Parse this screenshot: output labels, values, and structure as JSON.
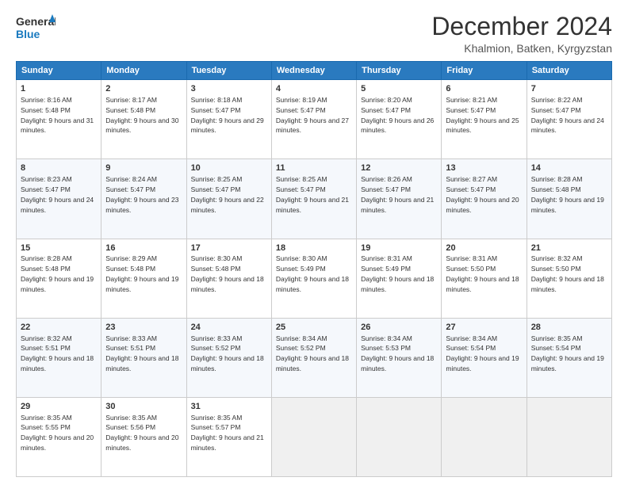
{
  "logo": {
    "line1": "General",
    "line2": "Blue"
  },
  "title": "December 2024",
  "subtitle": "Khalmion, Batken, Kyrgyzstan",
  "weekdays": [
    "Sunday",
    "Monday",
    "Tuesday",
    "Wednesday",
    "Thursday",
    "Friday",
    "Saturday"
  ],
  "weeks": [
    [
      {
        "day": "1",
        "sunrise": "8:16 AM",
        "sunset": "5:48 PM",
        "daylight": "9 hours and 31 minutes."
      },
      {
        "day": "2",
        "sunrise": "8:17 AM",
        "sunset": "5:48 PM",
        "daylight": "9 hours and 30 minutes."
      },
      {
        "day": "3",
        "sunrise": "8:18 AM",
        "sunset": "5:47 PM",
        "daylight": "9 hours and 29 minutes."
      },
      {
        "day": "4",
        "sunrise": "8:19 AM",
        "sunset": "5:47 PM",
        "daylight": "9 hours and 27 minutes."
      },
      {
        "day": "5",
        "sunrise": "8:20 AM",
        "sunset": "5:47 PM",
        "daylight": "9 hours and 26 minutes."
      },
      {
        "day": "6",
        "sunrise": "8:21 AM",
        "sunset": "5:47 PM",
        "daylight": "9 hours and 25 minutes."
      },
      {
        "day": "7",
        "sunrise": "8:22 AM",
        "sunset": "5:47 PM",
        "daylight": "9 hours and 24 minutes."
      }
    ],
    [
      {
        "day": "8",
        "sunrise": "8:23 AM",
        "sunset": "5:47 PM",
        "daylight": "9 hours and 24 minutes."
      },
      {
        "day": "9",
        "sunrise": "8:24 AM",
        "sunset": "5:47 PM",
        "daylight": "9 hours and 23 minutes."
      },
      {
        "day": "10",
        "sunrise": "8:25 AM",
        "sunset": "5:47 PM",
        "daylight": "9 hours and 22 minutes."
      },
      {
        "day": "11",
        "sunrise": "8:25 AM",
        "sunset": "5:47 PM",
        "daylight": "9 hours and 21 minutes."
      },
      {
        "day": "12",
        "sunrise": "8:26 AM",
        "sunset": "5:47 PM",
        "daylight": "9 hours and 21 minutes."
      },
      {
        "day": "13",
        "sunrise": "8:27 AM",
        "sunset": "5:47 PM",
        "daylight": "9 hours and 20 minutes."
      },
      {
        "day": "14",
        "sunrise": "8:28 AM",
        "sunset": "5:48 PM",
        "daylight": "9 hours and 19 minutes."
      }
    ],
    [
      {
        "day": "15",
        "sunrise": "8:28 AM",
        "sunset": "5:48 PM",
        "daylight": "9 hours and 19 minutes."
      },
      {
        "day": "16",
        "sunrise": "8:29 AM",
        "sunset": "5:48 PM",
        "daylight": "9 hours and 19 minutes."
      },
      {
        "day": "17",
        "sunrise": "8:30 AM",
        "sunset": "5:48 PM",
        "daylight": "9 hours and 18 minutes."
      },
      {
        "day": "18",
        "sunrise": "8:30 AM",
        "sunset": "5:49 PM",
        "daylight": "9 hours and 18 minutes."
      },
      {
        "day": "19",
        "sunrise": "8:31 AM",
        "sunset": "5:49 PM",
        "daylight": "9 hours and 18 minutes."
      },
      {
        "day": "20",
        "sunrise": "8:31 AM",
        "sunset": "5:50 PM",
        "daylight": "9 hours and 18 minutes."
      },
      {
        "day": "21",
        "sunrise": "8:32 AM",
        "sunset": "5:50 PM",
        "daylight": "9 hours and 18 minutes."
      }
    ],
    [
      {
        "day": "22",
        "sunrise": "8:32 AM",
        "sunset": "5:51 PM",
        "daylight": "9 hours and 18 minutes."
      },
      {
        "day": "23",
        "sunrise": "8:33 AM",
        "sunset": "5:51 PM",
        "daylight": "9 hours and 18 minutes."
      },
      {
        "day": "24",
        "sunrise": "8:33 AM",
        "sunset": "5:52 PM",
        "daylight": "9 hours and 18 minutes."
      },
      {
        "day": "25",
        "sunrise": "8:34 AM",
        "sunset": "5:52 PM",
        "daylight": "9 hours and 18 minutes."
      },
      {
        "day": "26",
        "sunrise": "8:34 AM",
        "sunset": "5:53 PM",
        "daylight": "9 hours and 18 minutes."
      },
      {
        "day": "27",
        "sunrise": "8:34 AM",
        "sunset": "5:54 PM",
        "daylight": "9 hours and 19 minutes."
      },
      {
        "day": "28",
        "sunrise": "8:35 AM",
        "sunset": "5:54 PM",
        "daylight": "9 hours and 19 minutes."
      }
    ],
    [
      {
        "day": "29",
        "sunrise": "8:35 AM",
        "sunset": "5:55 PM",
        "daylight": "9 hours and 20 minutes."
      },
      {
        "day": "30",
        "sunrise": "8:35 AM",
        "sunset": "5:56 PM",
        "daylight": "9 hours and 20 minutes."
      },
      {
        "day": "31",
        "sunrise": "8:35 AM",
        "sunset": "5:57 PM",
        "daylight": "9 hours and 21 minutes."
      },
      null,
      null,
      null,
      null
    ]
  ],
  "labels": {
    "sunrise": "Sunrise:",
    "sunset": "Sunset:",
    "daylight": "Daylight:"
  }
}
